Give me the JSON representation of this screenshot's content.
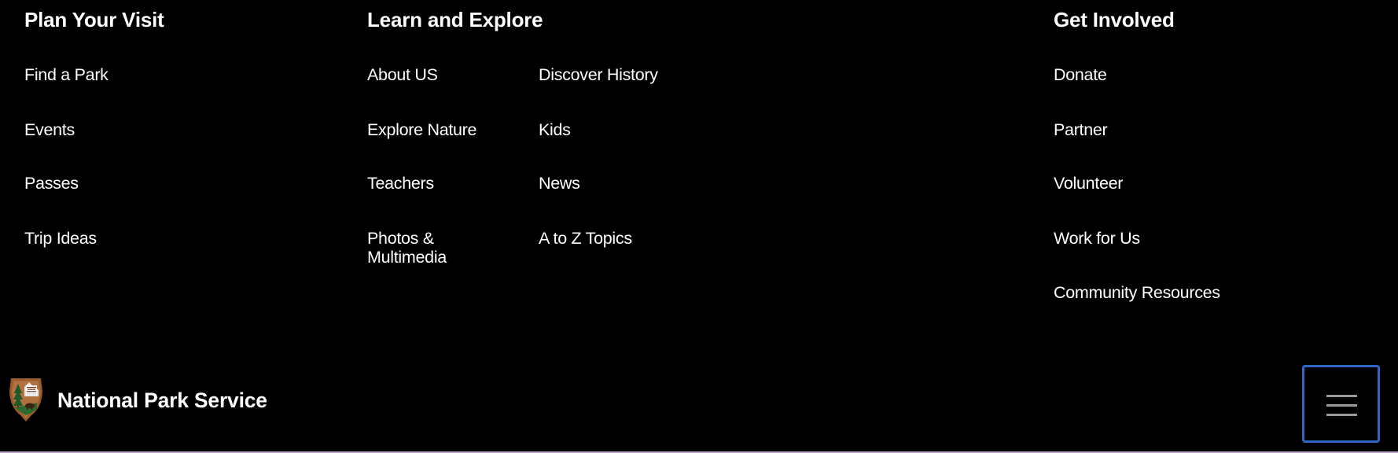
{
  "footer": {
    "columns": [
      {
        "heading": "Plan Your Visit",
        "links": [
          "Find a Park",
          "Events",
          "Passes",
          "Trip Ideas"
        ]
      },
      {
        "heading": "Learn and Explore",
        "links_left": [
          "About US",
          "Explore Nature",
          "Teachers",
          "Photos & Multimedia"
        ],
        "links_right": [
          "Discover History",
          "Kids",
          "News",
          "A to Z Topics"
        ]
      },
      {
        "heading": "Get Involved",
        "links": [
          "Donate",
          "Partner",
          "Volunteer",
          "Work for Us",
          "Community Resources"
        ]
      }
    ],
    "brand": {
      "name": "National Park Service",
      "logo_icon": "arrowhead-logo-icon",
      "logo_text": "NATIONAL PARK SERVICE"
    },
    "menu_button": {
      "icon": "hamburger-menu-icon",
      "focus_color": "#2f66c7"
    },
    "colors": {
      "background": "#000000",
      "text": "#ffffff"
    }
  }
}
